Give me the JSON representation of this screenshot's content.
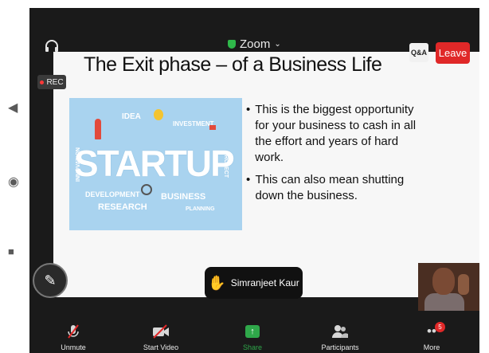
{
  "topbar": {
    "app_name": "Zoom",
    "qa_label": "Q&A",
    "leave_label": "Leave",
    "rec_label": "REC"
  },
  "slide": {
    "title": "The Exit phase – of a Business Life",
    "image_words": {
      "startup": "STARTUP",
      "idea": "IDEA",
      "investment": "INVESTMENT",
      "development": "DEVELOPMENT",
      "research": "RESEARCH",
      "business": "BUSINESS",
      "planning": "PLANNING",
      "innovation": "INNOVATION",
      "project": "PROJECT"
    },
    "bullets": [
      "This is the biggest opportunity for your business to cash in all the effort and years of hard work.",
      "This can also mean shutting down the business."
    ]
  },
  "speaker": {
    "name": "Simranjeet Kaur"
  },
  "toolbar": {
    "unmute": "Unmute",
    "start_video": "Start Video",
    "share": "Share",
    "participants": "Participants",
    "more": "More",
    "more_badge": "5"
  },
  "colors": {
    "leave": "#e02828",
    "share": "#2fa84a",
    "rec_dot": "#ff3838",
    "hand": "#3b82f6"
  }
}
